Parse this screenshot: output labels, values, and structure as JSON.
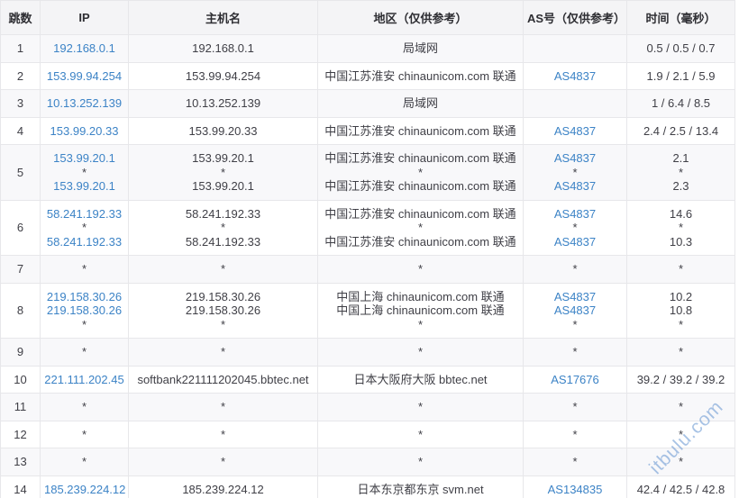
{
  "colors": {
    "link_blue": "#3c83c6",
    "header_bg": "#f4f4f6",
    "odd_row_bg": "#f8f8fa",
    "border": "#e7e7ea",
    "watermark_blue": "#6092d0"
  },
  "watermark": {
    "text": "itbulu.com"
  },
  "table": {
    "headers": [
      "跳数",
      "IP",
      "主机名",
      "地区（仅供参考）",
      "AS号（仅供参考）",
      "时间（毫秒）"
    ],
    "rows": [
      {
        "hop": "1",
        "ip": [
          "192.168.0.1"
        ],
        "host": [
          "192.168.0.1"
        ],
        "region": [
          "局域网"
        ],
        "asn": [
          ""
        ],
        "time": [
          "0.5 / 0.5 / 0.7"
        ]
      },
      {
        "hop": "2",
        "ip": [
          "153.99.94.254"
        ],
        "host": [
          "153.99.94.254"
        ],
        "region": [
          "中国江苏淮安 chinaunicom.com 联通"
        ],
        "asn": [
          "AS4837"
        ],
        "time": [
          "1.9 / 2.1 / 5.9"
        ]
      },
      {
        "hop": "3",
        "ip": [
          "10.13.252.139"
        ],
        "host": [
          "10.13.252.139"
        ],
        "region": [
          "局域网"
        ],
        "asn": [
          ""
        ],
        "time": [
          "1 / 6.4 / 8.5"
        ]
      },
      {
        "hop": "4",
        "ip": [
          "153.99.20.33"
        ],
        "host": [
          "153.99.20.33"
        ],
        "region": [
          "中国江苏淮安 chinaunicom.com 联通"
        ],
        "asn": [
          "AS4837"
        ],
        "time": [
          "2.4 / 2.5 / 13.4"
        ]
      },
      {
        "hop": "5",
        "ip": [
          "153.99.20.1",
          "*",
          "153.99.20.1"
        ],
        "host": [
          "153.99.20.1",
          "*",
          "153.99.20.1"
        ],
        "region": [
          "中国江苏淮安 chinaunicom.com 联通",
          "*",
          "中国江苏淮安 chinaunicom.com 联通"
        ],
        "asn": [
          "AS4837",
          "*",
          "AS4837"
        ],
        "time": [
          "2.1",
          "*",
          "2.3"
        ]
      },
      {
        "hop": "6",
        "ip": [
          "58.241.192.33",
          "*",
          "58.241.192.33"
        ],
        "host": [
          "58.241.192.33",
          "*",
          "58.241.192.33"
        ],
        "region": [
          "中国江苏淮安 chinaunicom.com 联通",
          "*",
          "中国江苏淮安 chinaunicom.com 联通"
        ],
        "asn": [
          "AS4837",
          "*",
          "AS4837"
        ],
        "time": [
          "14.6",
          "*",
          "10.3"
        ]
      },
      {
        "hop": "7",
        "ip": [
          "*"
        ],
        "host": [
          "*"
        ],
        "region": [
          "*"
        ],
        "asn": [
          "*"
        ],
        "time": [
          "*"
        ]
      },
      {
        "hop": "8",
        "ip": [
          "219.158.30.26",
          "219.158.30.26",
          "*"
        ],
        "host": [
          "219.158.30.26",
          "219.158.30.26",
          "*"
        ],
        "region": [
          "中国上海 chinaunicom.com 联通",
          "中国上海 chinaunicom.com 联通",
          "*"
        ],
        "asn": [
          "AS4837",
          "AS4837",
          "*"
        ],
        "time": [
          "10.2",
          "10.8",
          "*"
        ]
      },
      {
        "hop": "9",
        "ip": [
          "*"
        ],
        "host": [
          "*"
        ],
        "region": [
          "*"
        ],
        "asn": [
          "*"
        ],
        "time": [
          "*"
        ]
      },
      {
        "hop": "10",
        "ip": [
          "221.111.202.45"
        ],
        "host": [
          "softbank221111202045.bbtec.net"
        ],
        "region": [
          "日本大阪府大阪 bbtec.net"
        ],
        "asn": [
          "AS17676"
        ],
        "time": [
          "39.2 / 39.2 / 39.2"
        ]
      },
      {
        "hop": "11",
        "ip": [
          "*"
        ],
        "host": [
          "*"
        ],
        "region": [
          "*"
        ],
        "asn": [
          "*"
        ],
        "time": [
          "*"
        ]
      },
      {
        "hop": "12",
        "ip": [
          "*"
        ],
        "host": [
          "*"
        ],
        "region": [
          "*"
        ],
        "asn": [
          "*"
        ],
        "time": [
          "*"
        ]
      },
      {
        "hop": "13",
        "ip": [
          "*"
        ],
        "host": [
          "*"
        ],
        "region": [
          "*"
        ],
        "asn": [
          "*"
        ],
        "time": [
          "*"
        ]
      },
      {
        "hop": "14",
        "ip": [
          "185.239.224.12"
        ],
        "host": [
          "185.239.224.12"
        ],
        "region": [
          "日本东京都东京 svm.net"
        ],
        "asn": [
          "AS134835"
        ],
        "time": [
          "42.4 / 42.5 / 42.8"
        ]
      }
    ]
  }
}
